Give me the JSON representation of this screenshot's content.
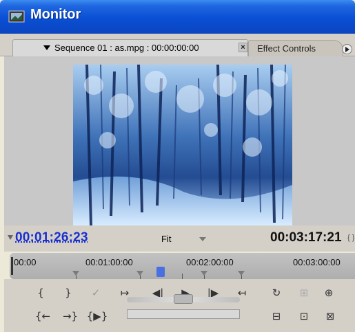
{
  "window": {
    "title": "Monitor"
  },
  "tabs": {
    "active_label": "Sequence 01 : as.mpg : 00:00:00:00",
    "close_label": "×",
    "inactive_label": "Effect Controls"
  },
  "timecode": {
    "current": "00:01:26:23",
    "zoom": "Fit",
    "duration": "00:03:17:21"
  },
  "ruler": {
    "labels": [
      "00:00",
      "00:01:00:00",
      "00:02:00:00",
      "00:03:00:00"
    ]
  },
  "controls": {
    "row1": [
      "{",
      "}",
      "✓",
      "↦",
      "◀|",
      "▶",
      "|▶",
      "↤",
      "↻",
      "⊞",
      "⊕"
    ],
    "row2": [
      "{←",
      "→}",
      "{▶}",
      "⊟",
      "⊡",
      "⊠"
    ]
  },
  "colors": {
    "title_bar": "#0a4fd4",
    "current_timecode": "#1a2fd0",
    "playhead": "#4a6fe0"
  }
}
